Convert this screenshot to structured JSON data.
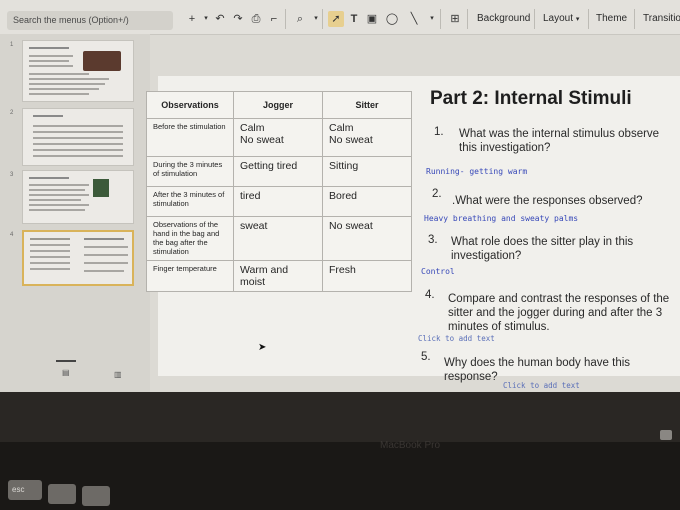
{
  "toolbar": {
    "search_placeholder": "Search the menus (Option+/)",
    "background_label": "Background",
    "layout_label": "Layout",
    "theme_label": "Theme",
    "transition_label": "Transitio"
  },
  "filmstrip": {
    "slide_numbers": [
      "1",
      "2",
      "3",
      "4"
    ]
  },
  "table": {
    "headers": [
      "Observations",
      "Jogger",
      "Sitter"
    ],
    "rows": [
      {
        "obs": "Before the stimulation",
        "jogger": "Calm\nNo sweat",
        "sitter": "Calm\nNo sweat"
      },
      {
        "obs": "During the 3 minutes of stimulation",
        "jogger": "Getting tired",
        "sitter": "Sitting"
      },
      {
        "obs": "After the 3 minutes of stimulation",
        "jogger": "tired",
        "sitter": "Bored"
      },
      {
        "obs": "Observations of the hand in the bag and the bag after the stimulation",
        "jogger": "sweat",
        "sitter": "No sweat"
      },
      {
        "obs": "Finger temperature",
        "jogger": "Warm and moist",
        "sitter": "Fresh"
      }
    ]
  },
  "slide": {
    "title": "Part 2: Internal Stimuli",
    "questions": [
      {
        "num": "1.",
        "line1": "What was the internal stimulus observe",
        "line2": "this investigation?"
      },
      {
        "num": "2.",
        "line1": ".What were the responses observed?",
        "line2": ""
      },
      {
        "num": "3.",
        "line1": "What role does the sitter play in this",
        "line2": "investigation?"
      },
      {
        "num": "4.",
        "line1": "Compare and contrast the responses of the",
        "line2": "sitter and the jogger during and after the 3",
        "line3": "minutes of stimulus."
      },
      {
        "num": "5.",
        "line1": "Why does the human body have this",
        "line2": "response?"
      }
    ],
    "answers": {
      "a1": "Running- getting warm",
      "a2": "Heavy breathing and sweaty palms",
      "a3": "Control",
      "a4_hint": "Click to add text",
      "a5_hint": "Click to add text"
    }
  },
  "keyboard": {
    "esc": "esc",
    "brand": "MacBook Pro"
  }
}
